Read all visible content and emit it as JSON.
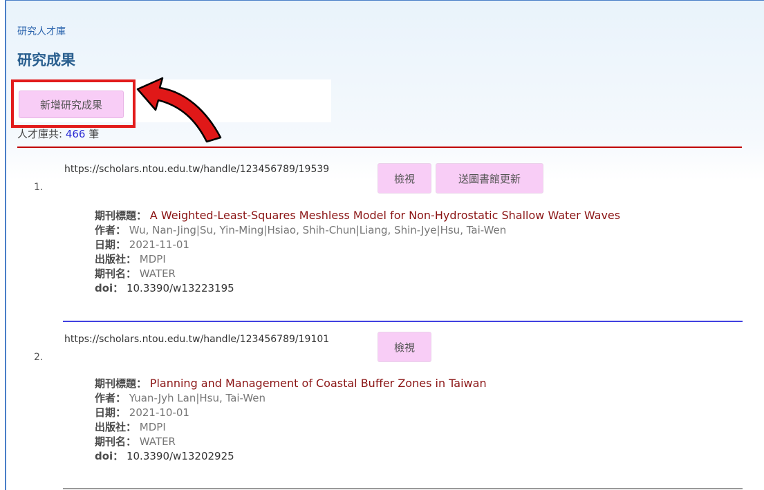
{
  "breadcrumb": "研究人才庫",
  "page_title": "研究成果",
  "add_button": "新增研究成果",
  "count": {
    "prefix": "人才庫共:",
    "value": "466",
    "suffix": "筆"
  },
  "labels": {
    "journal_title": "期刊標題：",
    "author": "作者：",
    "date": "日期：",
    "publisher": "出版社：",
    "journal_name": "期刊名：",
    "doi": "doi："
  },
  "buttons": {
    "view": "檢視",
    "send_library": "送圖書館更新"
  },
  "records": [
    {
      "index": "1.",
      "url": "https://scholars.ntou.edu.tw/handle/123456789/19539",
      "title": "A Weighted-Least-Squares Meshless Model for Non-Hydrostatic Shallow Water Waves",
      "author": "Wu, Nan-Jing|Su, Yin-Ming|Hsiao, Shih-Chun|Liang, Shin-Jye|Hsu, Tai-Wen",
      "date": "2021-11-01",
      "publisher": "MDPI",
      "journal": "WATER",
      "doi": "10.3390/w13223195"
    },
    {
      "index": "2.",
      "url": "https://scholars.ntou.edu.tw/handle/123456789/19101",
      "title": "Planning and Management of Coastal Buffer Zones in Taiwan",
      "author": "Yuan-Jyh Lan|Hsu, Tai-Wen",
      "date": "2021-10-01",
      "publisher": "MDPI",
      "journal": "WATER",
      "doi": "10.3390/w13202925"
    }
  ],
  "colors": {
    "accent_red": "#e21b1b",
    "button_pink": "#f8cdf6",
    "title_red": "#8a1313"
  }
}
